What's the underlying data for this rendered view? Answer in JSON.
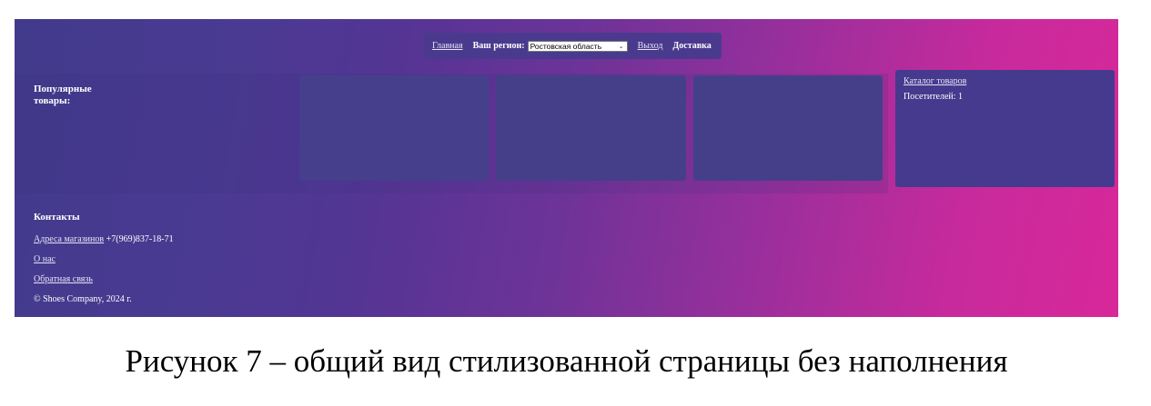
{
  "nav": {
    "home": "Главная",
    "region_label": "Ваш регион:",
    "region_value": "Ростовская область",
    "logout": "Выход",
    "delivery": "Доставка"
  },
  "popular": {
    "title": "Популярные товары:"
  },
  "sidebar": {
    "catalog": "Каталог товаров",
    "visitors": "Посетителей: 1"
  },
  "contacts": {
    "title": "Контакты",
    "stores": "Адреса магазинов",
    "phone": "+7(969)837-18-71",
    "about": "О нас",
    "feedback": "Обратная связь",
    "copyright": "© Shoes Company, 2024 г."
  },
  "caption": "Рисунок 7 – общий вид стилизованной страницы без наполнения",
  "colors": {
    "gradient_start": "#423a8c",
    "gradient_end": "#d8289a",
    "panel": "#463a8e"
  }
}
